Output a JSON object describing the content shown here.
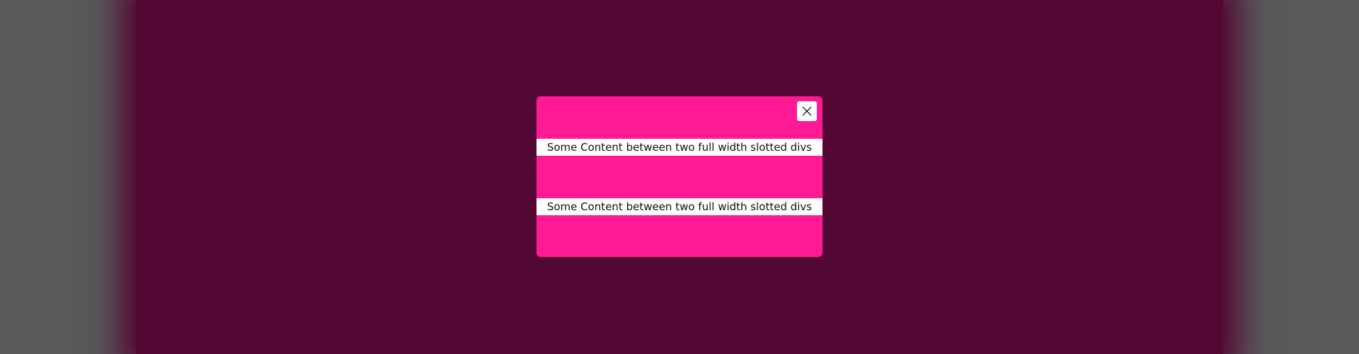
{
  "modal": {
    "close_icon": "close-icon",
    "slots": [
      {
        "text": "Some Content between two full width slotted divs"
      },
      {
        "text": "Some Content between two full width slotted divs"
      }
    ]
  },
  "colors": {
    "page_background": "#58595b",
    "backdrop": "#530834",
    "modal_background": "#ff1993",
    "slot_background": "#ffffff",
    "text": "#111111"
  }
}
